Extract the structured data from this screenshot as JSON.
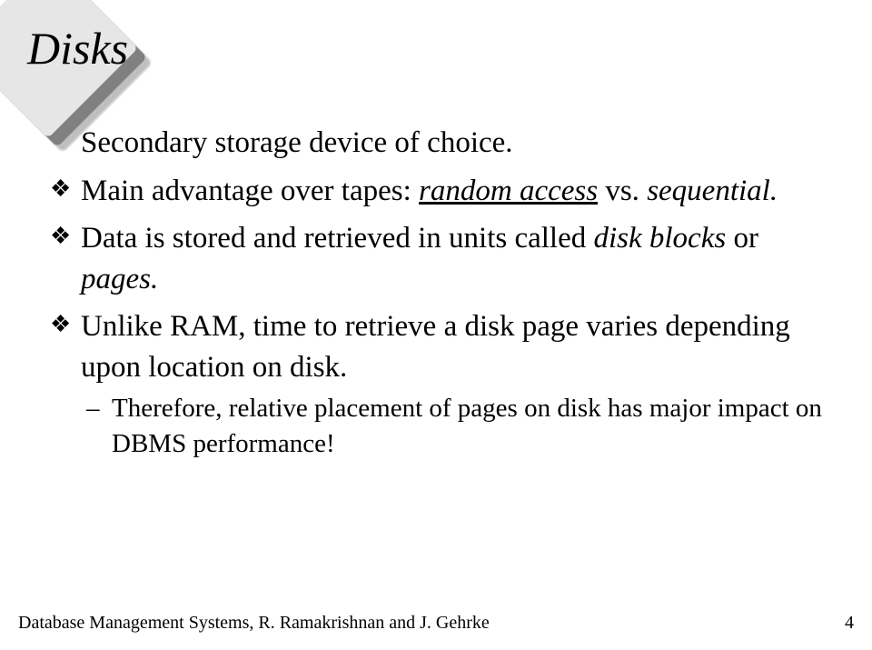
{
  "title": "Disks",
  "bullets": {
    "b1_pre": "Secondary storage device of choice.",
    "b2_pre": "Main advantage over tapes: ",
    "b2_u": "random access",
    "b2_mid": " vs. ",
    "b2_it": "sequential.",
    "b3_pre": "Data is stored and retrieved in units called ",
    "b3_it": "disk blocks",
    "b3_mid": " or ",
    "b3_it2": "pages.",
    "b4": "Unlike RAM, time to retrieve a disk page varies depending upon location on disk.",
    "s1": "Therefore, relative placement of pages on disk has major impact on DBMS performance!"
  },
  "footer": {
    "text": "Database Management Systems, R. Ramakrishnan and J. Gehrke",
    "page": "4"
  }
}
